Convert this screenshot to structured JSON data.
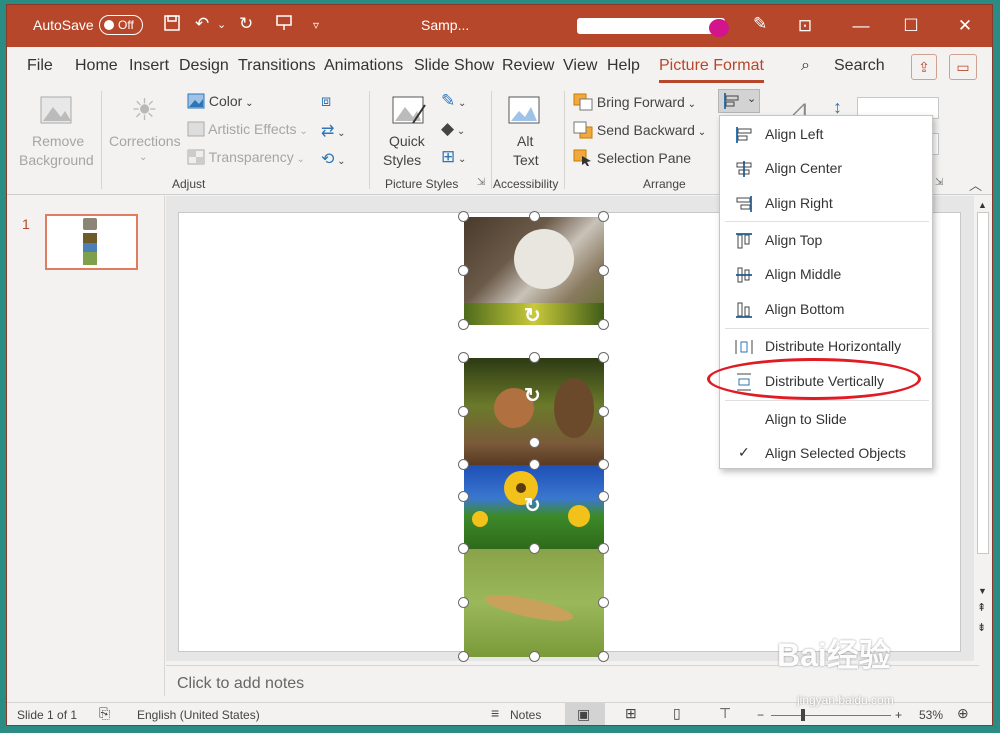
{
  "titlebar": {
    "autosave": "AutoSave",
    "toggle": "Off",
    "doc_title": "Samp..."
  },
  "tabs": [
    "File",
    "Home",
    "Insert",
    "Design",
    "Transitions",
    "Animations",
    "Slide Show",
    "Review",
    "View",
    "Help",
    "Picture Format"
  ],
  "search_label": "Search",
  "ribbon": {
    "remove_bg_1": "Remove",
    "remove_bg_2": "Background",
    "corrections": "Corrections",
    "color": "Color",
    "artistic": "Artistic Effects",
    "transparency": "Transparency",
    "group_adjust": "Adjust",
    "quick_1": "Quick",
    "quick_2": "Styles",
    "group_styles": "Picture Styles",
    "alt_1": "Alt",
    "alt_2": "Text",
    "group_access": "Accessibility",
    "bring_forward": "Bring Forward",
    "send_backward": "Send Backward",
    "selection_pane": "Selection Pane",
    "group_arrange": "Arrange"
  },
  "slides_panel": {
    "number": "1"
  },
  "notes_placeholder": "Click to add notes",
  "status": {
    "slide": "Slide 1 of 1",
    "language": "English (United States)",
    "notes": "Notes",
    "zoom": "53%"
  },
  "align_menu": {
    "items": [
      "Align Left",
      "Align Center",
      "Align Right",
      "Align Top",
      "Align Middle",
      "Align Bottom",
      "Distribute Horizontally",
      "Distribute Vertically",
      "Align to Slide",
      "Align Selected Objects"
    ],
    "checked_item": "Align Selected Objects",
    "highlighted_item": "Distribute Vertically"
  },
  "watermark": {
    "brand": "Bai经验",
    "url": "jingyan.baidu.com"
  },
  "colors": {
    "accent": "#b7472a",
    "highlight_oval": "#e01b24"
  }
}
